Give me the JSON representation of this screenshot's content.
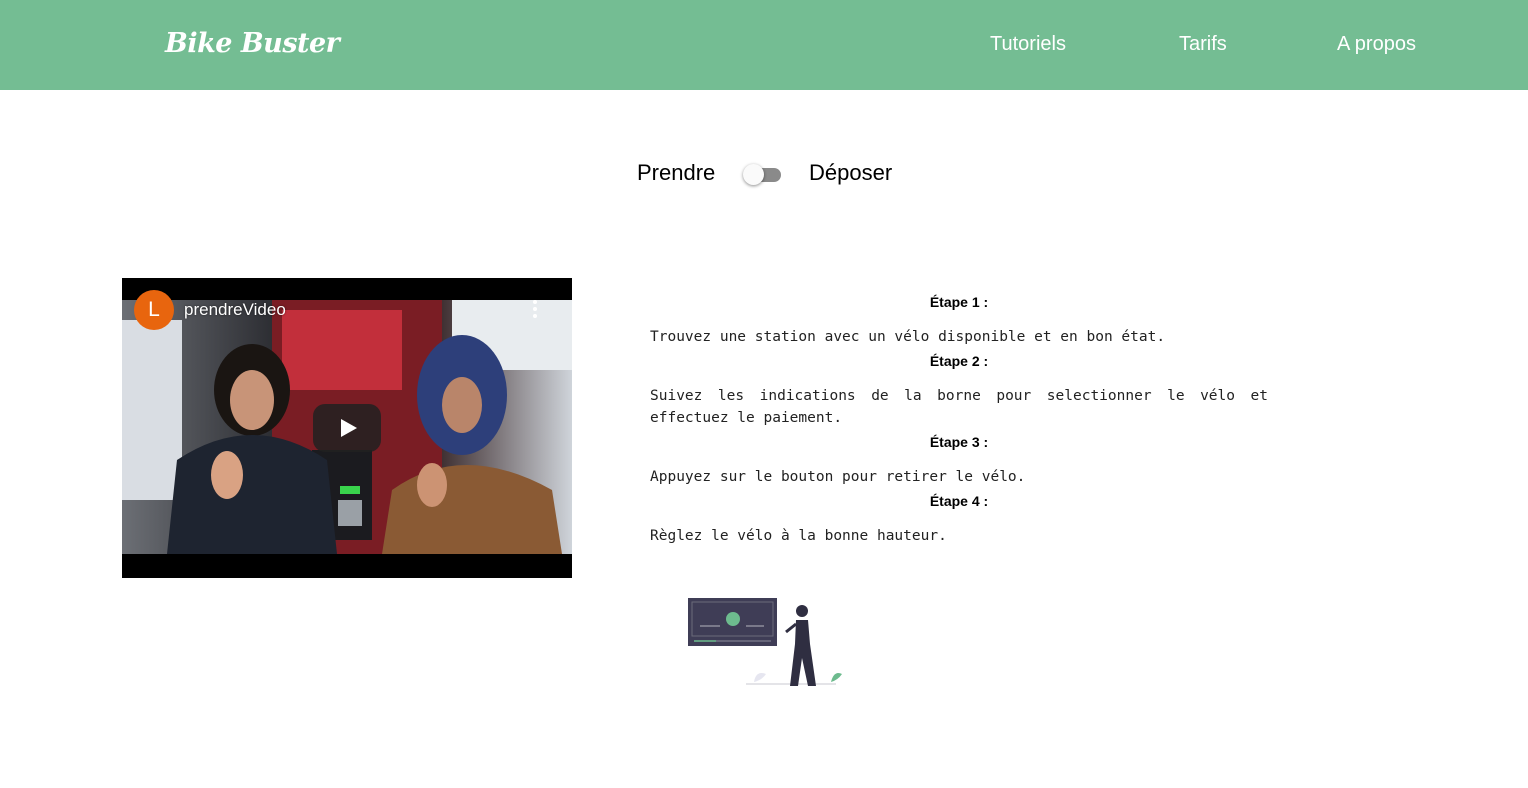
{
  "navbar": {
    "brand": "Bike Buster",
    "links": [
      "Tutoriels",
      "Tarifs",
      "A propos"
    ]
  },
  "toggle": {
    "left_label": "Prendre",
    "right_label": "Déposer",
    "checked": false
  },
  "video": {
    "channel_initial": "L",
    "title": "prendreVideo"
  },
  "steps": [
    {
      "title": "Étape 1 :",
      "text": "Trouvez une station avec un vélo disponible et en bon état."
    },
    {
      "title": "Étape 2 :",
      "text": "Suivez les indications de la borne pour selectionner le vélo et effectuez le paiement."
    },
    {
      "title": "Étape 3 :",
      "text": "Appuyez sur le bouton pour retirer le vélo."
    },
    {
      "title": "Étape 4 :",
      "text": "Règlez le vélo à la bonne hauteur."
    }
  ],
  "colors": {
    "navbar": "#74bd93",
    "accent_green": "#6dbb8e",
    "avatar": "#e8650e"
  },
  "icons": [
    "kebab-menu-icon",
    "play-icon"
  ]
}
